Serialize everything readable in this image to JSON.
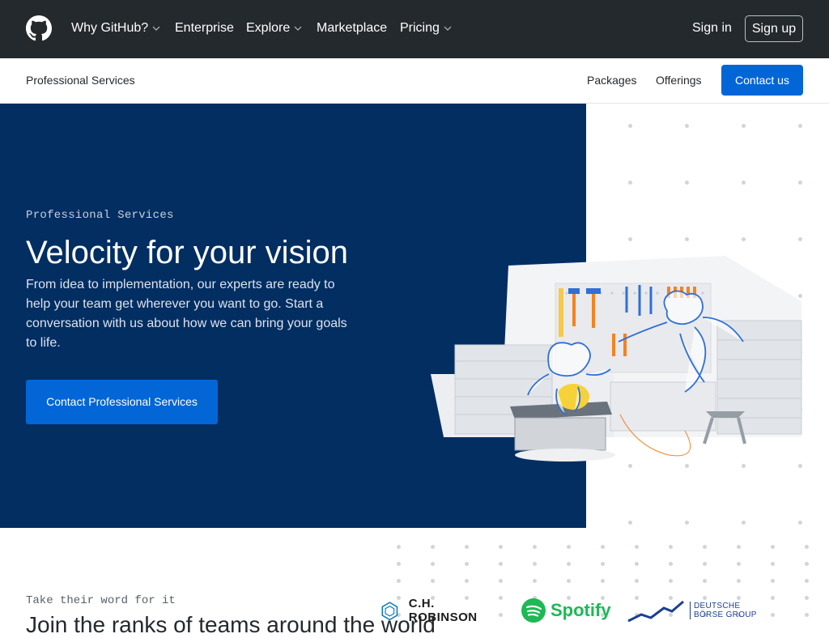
{
  "nav": {
    "items": [
      {
        "label": "Why GitHub?",
        "dropdown": true
      },
      {
        "label": "Enterprise",
        "dropdown": false
      },
      {
        "label": "Explore",
        "dropdown": true
      },
      {
        "label": "Marketplace",
        "dropdown": false
      },
      {
        "label": "Pricing",
        "dropdown": true
      }
    ],
    "sign_in": "Sign in",
    "sign_up": "Sign up"
  },
  "subnav": {
    "title": "Professional Services",
    "links": [
      "Packages",
      "Offerings"
    ],
    "contact": "Contact us"
  },
  "hero": {
    "eyebrow": "Professional Services",
    "title": "Velocity for your vision",
    "text": "From idea to implementation, our experts are ready to help your team get wherever you want to go. Start a conversation with us about how we can bring your goals to life.",
    "cta": "Contact Professional Services"
  },
  "testimonials": {
    "eyebrow": "Take their word for it",
    "heading": "Join the ranks of teams around the world",
    "logos": [
      {
        "name": "C.H. ROBINSON"
      },
      {
        "name": "Spotify"
      },
      {
        "name": "DEUTSCHE BÖRSE GROUP"
      }
    ]
  },
  "colors": {
    "nav_bg": "#24292e",
    "hero_bg": "#032e62",
    "primary_button": "#0366d6",
    "spotify": "#1db954",
    "ch_robinson": "#0a7abf",
    "deutsche_borse": "#1c3f94"
  }
}
